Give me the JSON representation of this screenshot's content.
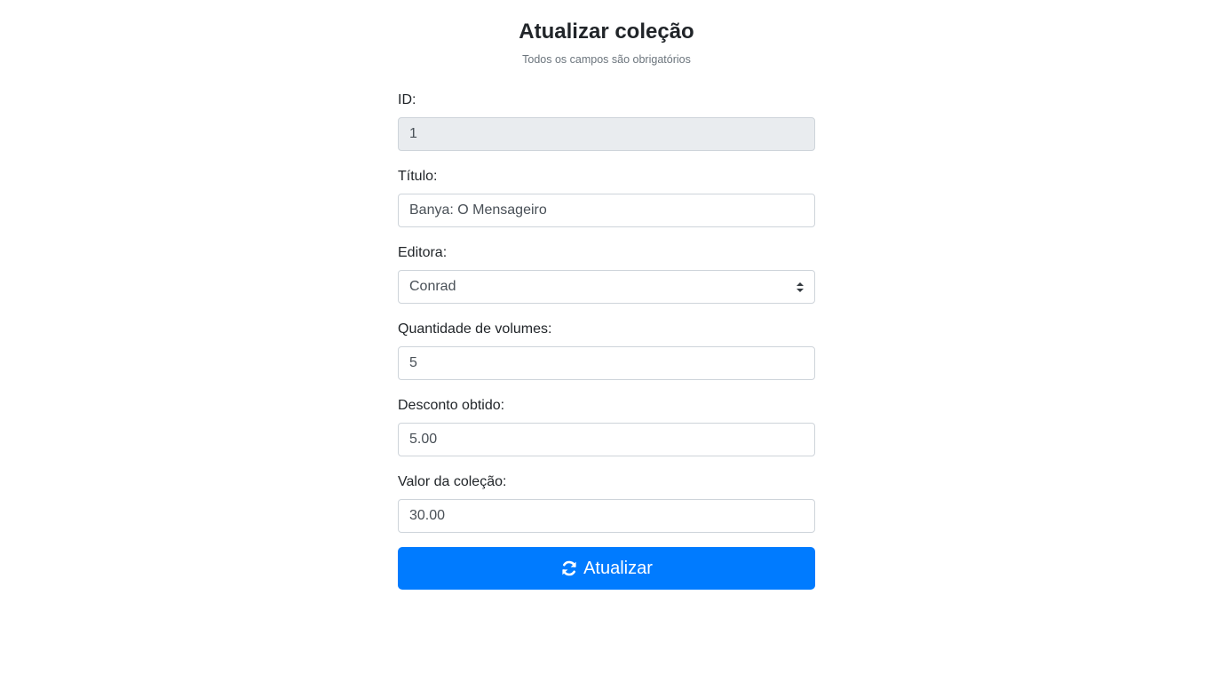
{
  "header": {
    "title": "Atualizar coleção",
    "subtitle": "Todos os campos são obrigatórios"
  },
  "form": {
    "id": {
      "label": "ID:",
      "value": "1"
    },
    "titulo": {
      "label": "Título:",
      "value": "Banya: O Mensageiro"
    },
    "editora": {
      "label": "Editora:",
      "selected": "Conrad"
    },
    "quantidade": {
      "label": "Quantidade de volumes:",
      "value": "5"
    },
    "desconto": {
      "label": "Desconto obtido:",
      "value": "5.00"
    },
    "valor": {
      "label": "Valor da coleção:",
      "value": "30.00"
    }
  },
  "actions": {
    "submit_label": "Atualizar",
    "submit_icon": "refresh-icon"
  },
  "colors": {
    "primary": "#007bff",
    "readonly_bg": "#e9ecef",
    "border": "#ced4da",
    "muted_text": "#6c757d"
  }
}
